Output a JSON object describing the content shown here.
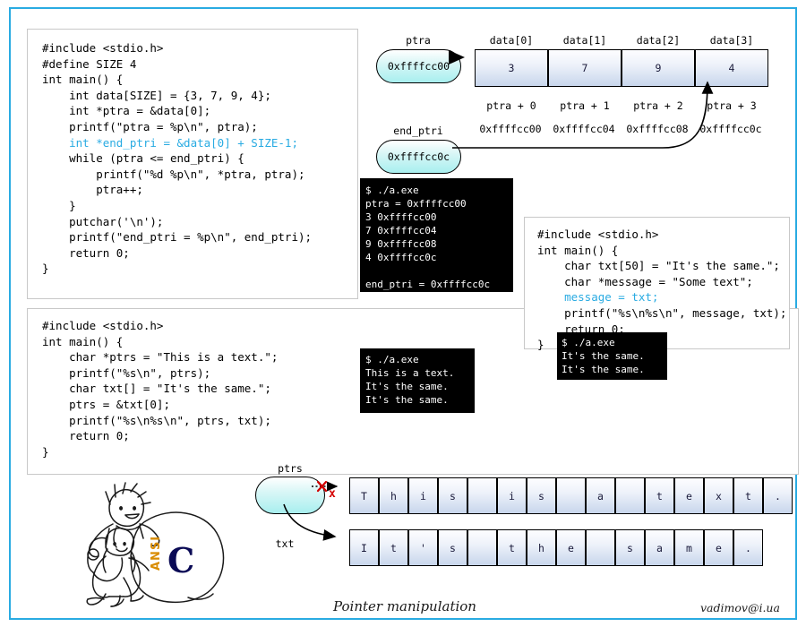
{
  "slide": {
    "border_color": "#29ABE2",
    "footer_title": "Pointer manipulation",
    "footer_email": "vadimov@i.ua"
  },
  "code_panels": [
    {
      "name": "array-pointer-code",
      "lines": [
        "#include <stdio.h>",
        "#define SIZE 4",
        "int main() {",
        "    int data[SIZE] = {3, 7, 9, 4};",
        "    int *ptra = &data[0];",
        "    printf(\"ptra = %p\\n\", ptra);",
        "    int *end_ptri = &data[0] + SIZE-1;",
        "    while (ptra <= end_ptri) {",
        "        printf(\"%d %p\\n\", *ptra, ptra);",
        "        ptra++;",
        "    }",
        "    putchar('\\n');",
        "    printf(\"end_ptri = %p\\n\", end_ptri);",
        "    return 0;",
        "}"
      ],
      "highlight_line_index": 6
    },
    {
      "name": "string-assign-code",
      "lines": [
        "#include <stdio.h>",
        "int main() {",
        "    char txt[50] = \"It's the same.\";",
        "    char *message = \"Some text\";",
        "    message = txt;",
        "    printf(\"%s\\n%s\\n\", message, txt);",
        "    return 0;",
        "}"
      ],
      "highlight_line_index": 4
    },
    {
      "name": "string-pointer-code",
      "lines": [
        "#include <stdio.h>",
        "int main() {",
        "    char *ptrs = \"This is a text.\";",
        "    printf(\"%s\\n\", ptrs);",
        "    char txt[] = \"It's the same.\";",
        "    ptrs = &txt[0];",
        "    printf(\"%s\\n%s\\n\", ptrs, txt);",
        "    return 0;",
        "}"
      ],
      "highlight_line_index": -1
    }
  ],
  "terminals": [
    {
      "name": "array-pointer-output",
      "text": "$ ./a.exe\nptra = 0xffffcc00\n3 0xffffcc00\n7 0xffffcc04\n9 0xffffcc08\n4 0xffffcc0c\n\nend_ptri = 0xffffcc0c"
    },
    {
      "name": "string-assign-output",
      "text": "$ ./a.exe\nIt's the same.\nIt's the same."
    },
    {
      "name": "string-pointer-output",
      "text": "$ ./a.exe\nThis is a text.\nIt's the same.\nIt's the same."
    }
  ],
  "array_diagram": {
    "ptra_label": "ptra",
    "ptra_value": "0xffffcc00",
    "end_ptri_label": "end_ptri",
    "end_ptri_value": "0xffffcc0c",
    "headers": [
      "data[0]",
      "data[1]",
      "data[2]",
      "data[3]"
    ],
    "values": [
      "3",
      "7",
      "9",
      "4"
    ],
    "offsets": [
      "ptra + 0",
      "ptra + 1",
      "ptra + 2",
      "ptra + 3"
    ],
    "addresses": [
      "0xffffcc00",
      "0xffffcc04",
      "0xffffcc08",
      "0xffffcc0c"
    ]
  },
  "string_diagram": {
    "ptrs_label": "ptrs",
    "txt_label": "txt",
    "crossed_marker": "x",
    "row1_chars": [
      "T",
      "h",
      "i",
      "s",
      " ",
      "i",
      "s",
      " ",
      "a",
      " ",
      "t",
      "e",
      "x",
      "t",
      "."
    ],
    "row2_chars": [
      "I",
      "t",
      "'",
      "s",
      " ",
      "t",
      "h",
      "e",
      " ",
      "s",
      "a",
      "m",
      "e",
      "."
    ]
  },
  "mascot": {
    "name": "ansi-c-snowball-drawing",
    "ball_text_vertical": "ANSI",
    "ball_text_big": "C"
  }
}
